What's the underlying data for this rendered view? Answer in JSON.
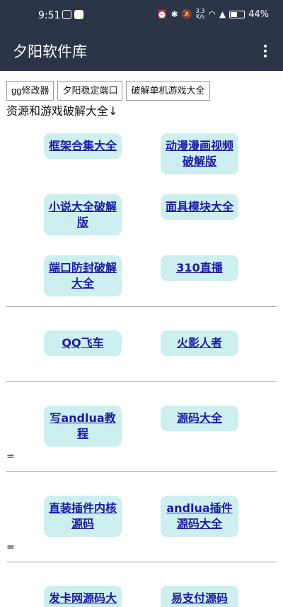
{
  "status_bar": {
    "time": "9:51",
    "net_speed_value": "3.3",
    "net_speed_unit": "K/s",
    "battery": "44%",
    "battery_level": 0.44
  },
  "app_bar": {
    "title": "夕阳软件库",
    "menu_icon": "more-vert-icon"
  },
  "top_buttons": [
    "gg修改器",
    "夕阳稳定端口",
    "破解单机游戏大全"
  ],
  "subtitle": "资源和游戏破解大全↓",
  "links": [
    "框架合集大全",
    "动漫漫画视频破解版",
    "小说大全破解版",
    "面具模块大全",
    "端口防封破解大全",
    "310直播",
    "QQ飞车",
    "火影人者",
    "写andlua教程",
    "源码大全",
    "直装插件内核源码",
    "andlua插件源码大全",
    "发卡网源码大",
    "易支付源码"
  ],
  "equals_marks": [
    "=",
    "="
  ],
  "colors": {
    "header_bg": "#2c3548",
    "button_bg": "#cdeff0",
    "link_text": "#1a1aa6"
  }
}
